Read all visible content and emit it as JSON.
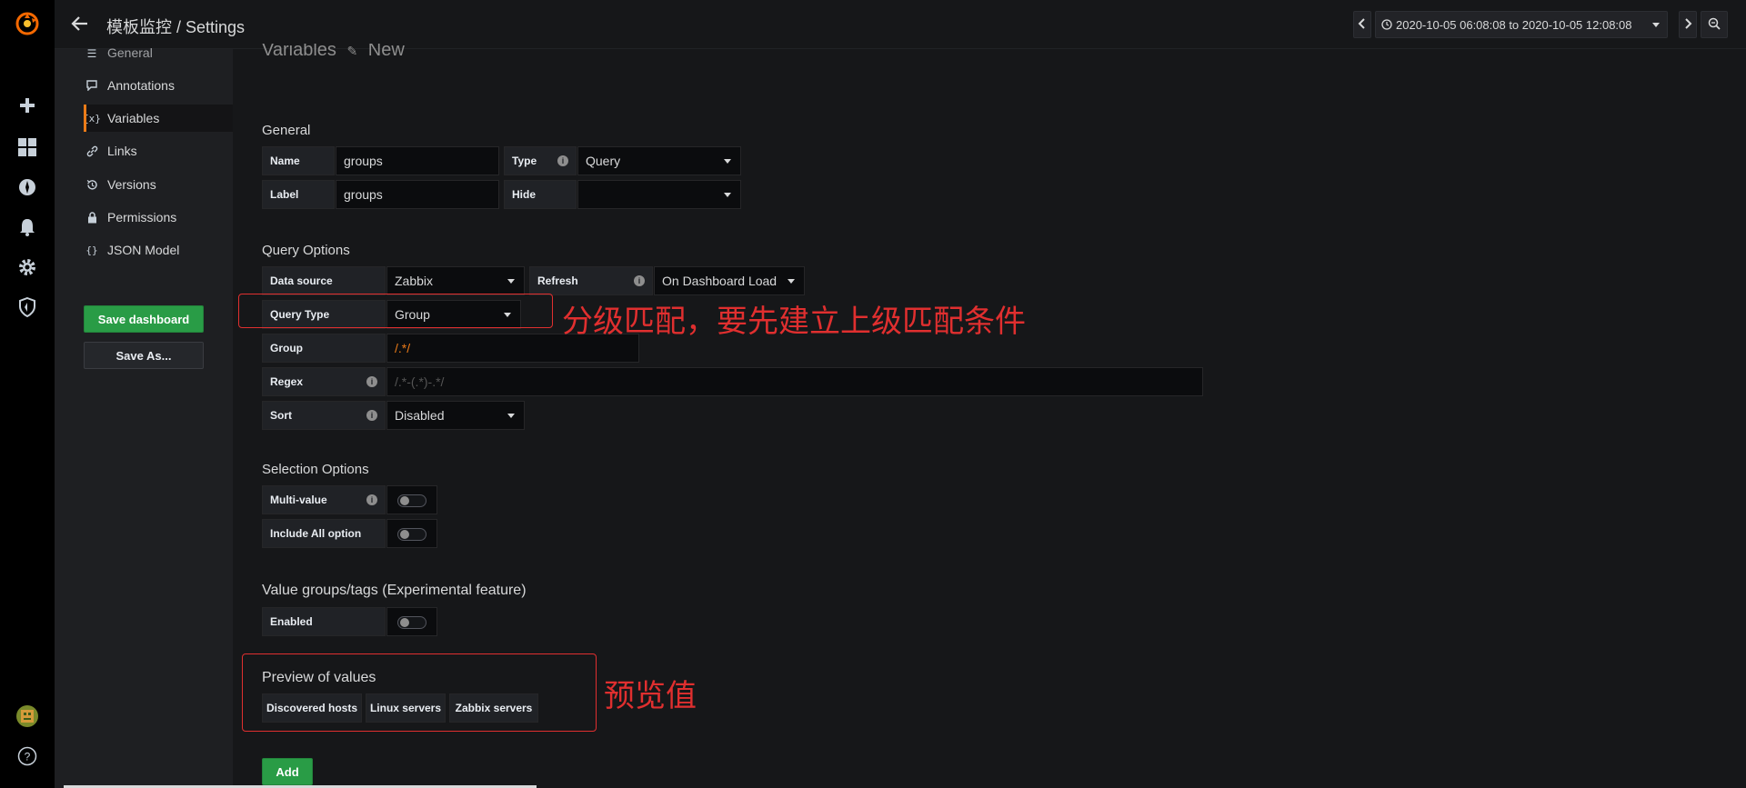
{
  "app": {
    "title": "模板监控 / Settings",
    "brand_color": "#eb7b18",
    "accent_green": "#299c46",
    "annotation_color": "#e02f2f"
  },
  "sidenav": {
    "icons": [
      "grafana-logo-icon",
      "plus-icon",
      "dashboards-icon",
      "explore-icon",
      "alerting-bell-icon",
      "configuration-gear-icon",
      "server-admin-shield-icon",
      "user-avatar-icon",
      "help-icon"
    ]
  },
  "topbar": {
    "time_range": "2020-10-05 06:08:08 to 2020-10-05 12:08:08"
  },
  "settings_nav": {
    "items": [
      {
        "label": "General"
      },
      {
        "label": "Annotations"
      },
      {
        "label": "Variables"
      },
      {
        "label": "Links"
      },
      {
        "label": "Versions"
      },
      {
        "label": "Permissions"
      },
      {
        "label": "JSON Model"
      }
    ],
    "save_dashboard": "Save dashboard",
    "save_as": "Save As..."
  },
  "main": {
    "heading": "Variables",
    "heading_sub": "New",
    "general": {
      "title": "General",
      "name_label": "Name",
      "name_value": "groups",
      "type_label": "Type",
      "type_value": "Query",
      "label_label": "Label",
      "label_value": "groups",
      "hide_label": "Hide",
      "hide_value": ""
    },
    "query_options": {
      "title": "Query Options",
      "datasource_label": "Data source",
      "datasource_value": "Zabbix",
      "refresh_label": "Refresh",
      "refresh_value": "On Dashboard Load",
      "query_type_label": "Query Type",
      "query_type_value": "Group",
      "group_label": "Group",
      "group_value": "/.*/",
      "regex_label": "Regex",
      "regex_placeholder": "/.*-(.*)-.*/",
      "sort_label": "Sort",
      "sort_value": "Disabled"
    },
    "selection_options": {
      "title": "Selection Options",
      "multi_value_label": "Multi-value",
      "multi_value": false,
      "include_all_label": "Include All option",
      "include_all": false
    },
    "value_groups": {
      "title": "Value groups/tags (Experimental feature)",
      "enabled_label": "Enabled",
      "enabled": false
    },
    "preview": {
      "title": "Preview of values",
      "values": [
        "Discovered hosts",
        "Linux servers",
        "Zabbix servers"
      ]
    },
    "add_button": "Add"
  },
  "annotations": {
    "query_type_note": "分级匹配，要先建立上级匹配条件",
    "preview_note": "预览值"
  }
}
